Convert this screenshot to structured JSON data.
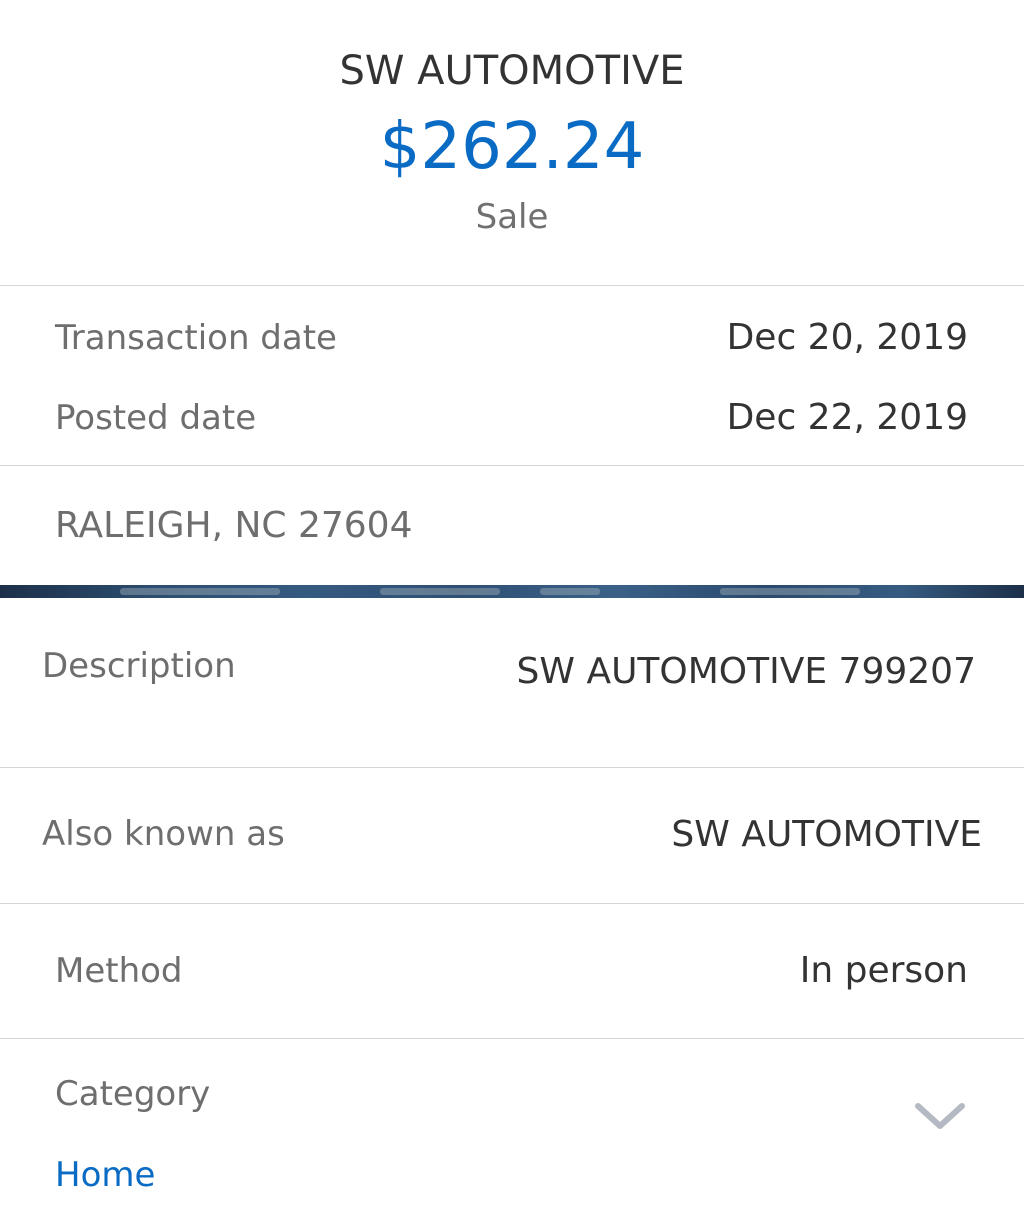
{
  "header": {
    "merchant": "SW AUTOMOTIVE",
    "amount": "$262.24",
    "type": "Sale"
  },
  "dates": {
    "transaction_label": "Transaction date",
    "transaction_value": "Dec 20, 2019",
    "posted_label": "Posted date",
    "posted_value": "Dec 22, 2019"
  },
  "location": "RALEIGH, NC 27604",
  "details": {
    "description_label": "Description",
    "description_value": "SW AUTOMOTIVE 799207",
    "aka_label": "Also known as",
    "aka_value": "SW AUTOMOTIVE",
    "method_label": "Method",
    "method_value": "In person"
  },
  "category": {
    "label": "Category",
    "value": "Home",
    "icon": "chevron-down-icon"
  },
  "colors": {
    "accent": "#0a6bc4",
    "text_primary": "#333333",
    "text_secondary": "#6e6e6e",
    "divider": "#d6d6d6"
  }
}
